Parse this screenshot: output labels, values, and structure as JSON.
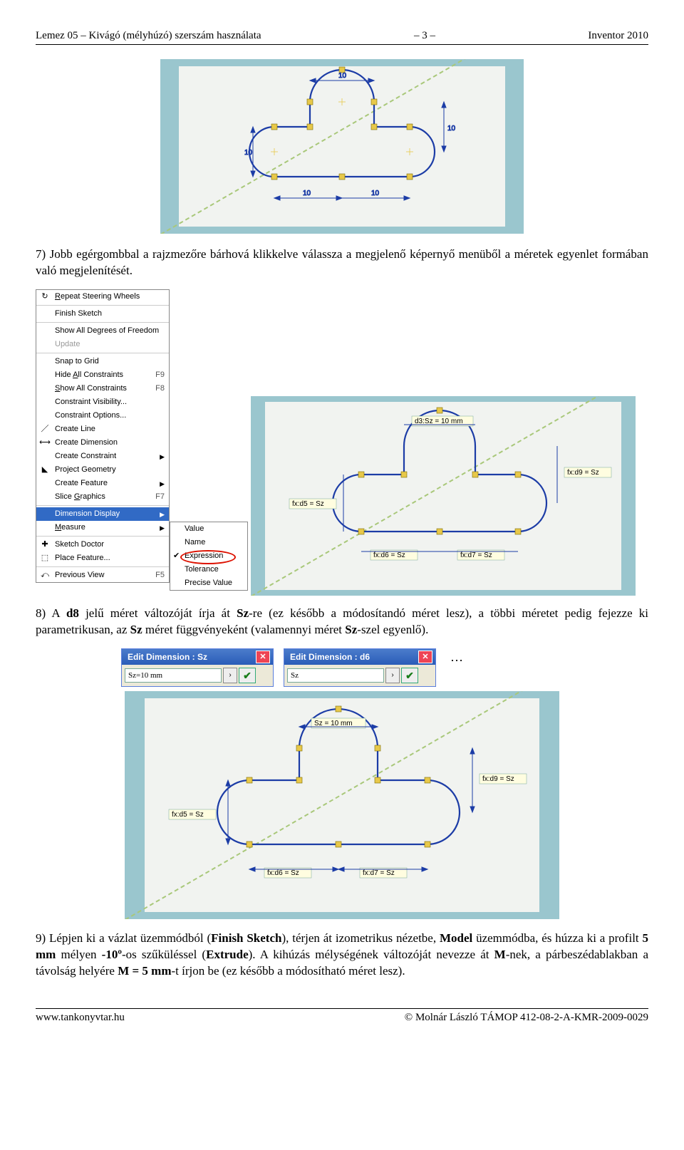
{
  "header": {
    "left": "Lemez 05 – Kivágó (mélyhúzó) szerszám használata",
    "center": "– 3 –",
    "right": "Inventor 2010"
  },
  "footer": {
    "left": "www.tankonyvtar.hu",
    "right": "© Molnár László TÁMOP 412-08-2-A-KMR-2009-0029"
  },
  "paragraphs": {
    "p7_prefix": "7) ",
    "p7": "Jobb egérgombbal a rajzmezőre bárhová klikkelve válassza a megjelenő képernyő menüből a méretek egyenlet formában való megjelenítését.",
    "p8_prefix": "8) ",
    "p8_a": "A ",
    "p8_b": "d8",
    "p8_c": " jelű méret változóját írja át ",
    "p8_d": "Sz",
    "p8_e": "-re (ez később a módosítandó méret lesz), a többi méretet pedig fejezze ki parametrikusan, az ",
    "p8_f": "Sz",
    "p8_g": " méret függvényeként (valamennyi méret ",
    "p8_h": "Sz",
    "p8_i": "-szel egyenlő).",
    "p9_prefix": "9) ",
    "p9_a": "Lépjen ki a vázlat üzemmódból (",
    "p9_b": "Finish Sketch",
    "p9_c": "), térjen át izometrikus nézetbe, ",
    "p9_d": "Model",
    "p9_e": " üzemmódba, és húzza ki a profilt ",
    "p9_f": "5 mm",
    "p9_g": " mélyen ",
    "p9_h": "-10º",
    "p9_i": "-os szűküléssel (",
    "p9_j": "Extrude",
    "p9_k": "). A kihúzás mélységének változóját nevezze át ",
    "p9_l": "M",
    "p9_m": "-nek, a párbeszédablakban a távolság helyére ",
    "p9_n": "M = 5 mm",
    "p9_o": "-t írjon be (ez később a módosítható méret lesz)."
  },
  "context_menu": {
    "repeat": "Repeat Steering Wheels",
    "finish_sketch": "Finish Sketch",
    "show_dof": "Show All Degrees of Freedom",
    "update": "Update",
    "snap_grid": "Snap to Grid",
    "hide_constraints": "Hide All Constraints",
    "hide_constraints_sc": "F9",
    "show_constraints": "Show All Constraints",
    "show_constraints_sc": "F8",
    "constraint_vis": "Constraint Visibility...",
    "constraint_opt": "Constraint Options...",
    "create_line": "Create Line",
    "create_dim": "Create Dimension",
    "create_constraint": "Create Constraint",
    "project_geom": "Project Geometry",
    "create_feature": "Create Feature",
    "slice_graphics": "Slice Graphics",
    "slice_graphics_sc": "F7",
    "dimension_display": "Dimension Display",
    "measure": "Measure",
    "sketch_doctor": "Sketch Doctor",
    "place_feature": "Place Feature...",
    "previous_view": "Previous View",
    "previous_view_sc": "F5"
  },
  "submenu": {
    "value": "Value",
    "name": "Name",
    "expression": "Expression",
    "tolerance": "Tolerance",
    "precise_value": "Precise Value"
  },
  "dialogs": {
    "d1_title": "Edit Dimension : Sz",
    "d1_value": "Sz=10 mm",
    "d2_title": "Edit Dimension : d6",
    "d2_value": "Sz"
  },
  "sketch_labels": {
    "top_dim": "10",
    "left_dim": "10",
    "right_dim": "10",
    "bottom_left": "10",
    "bottom_right": "10",
    "expr_top": "d3:Sz = 10 mm",
    "expr_left": "fx:d5 = Sz",
    "expr_right": "fx:d9 = Sz",
    "expr_bleft": "fx:d6 = Sz",
    "expr_bright": "fx:d7 = Sz",
    "fig4_top": "Sz = 10 mm",
    "fig4_left": "fx:d5 = Sz",
    "fig4_right": "fx:d9 = Sz",
    "fig4_bleft": "fx:d6 = Sz",
    "fig4_bright": "fx:d7 = Sz"
  },
  "ellipsis": "…"
}
